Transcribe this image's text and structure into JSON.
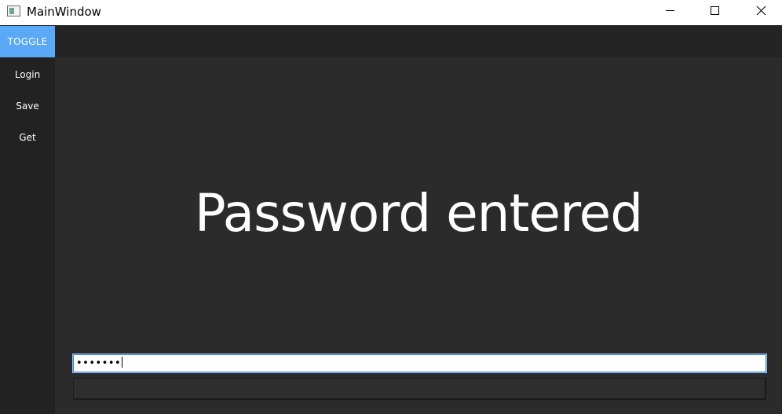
{
  "window": {
    "title": "MainWindow"
  },
  "sidebar": {
    "toggle_label": "TOGGLE",
    "items": [
      {
        "label": "Login"
      },
      {
        "label": "Save"
      },
      {
        "label": "Get"
      }
    ]
  },
  "main": {
    "status_label": "Password entered",
    "password_value": "•••••••",
    "submit_label": ""
  },
  "colors": {
    "accent": "#5aa9f7",
    "background": "#2b2b2b",
    "sidebar": "#222222",
    "topbar": "#242424"
  },
  "icons": {
    "app": "app-window-icon",
    "minimize": "minimize-icon",
    "maximize": "maximize-icon",
    "close": "close-icon"
  }
}
